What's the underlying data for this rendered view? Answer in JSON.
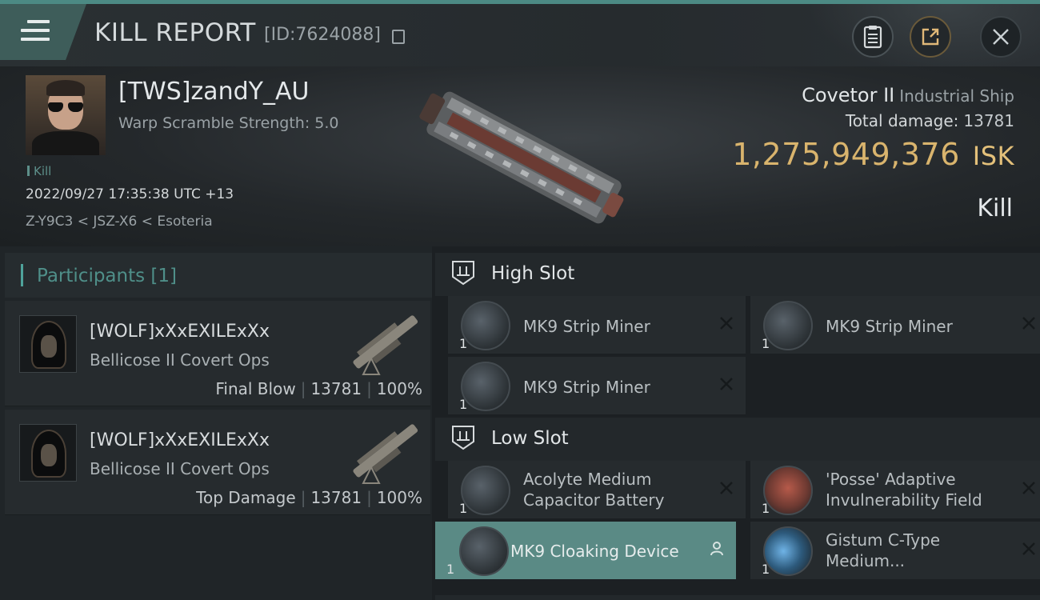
{
  "header": {
    "title": "KILL REPORT",
    "report_id": "[ID:7624088]"
  },
  "victim": {
    "name": "[TWS]zandY_AU",
    "warp_scramble": "Warp Scramble Strength: 5.0",
    "tag": "Kill",
    "datetime": "2022/09/27 17:35:38 UTC +13",
    "location": "Z-Y9C3 < JSZ-X6 < Esoteria"
  },
  "ship": {
    "name": "Covetor II",
    "class": "Industrial Ship",
    "total_damage_label": "Total damage:",
    "total_damage": "13781",
    "isk_value": "1,275,949,376",
    "isk_unit": "ISK",
    "result": "Kill"
  },
  "participants": {
    "label": "Participants",
    "count": "[1]",
    "items": [
      {
        "name": "[WOLF]xXxEXILExXx",
        "ship": "Bellicose II Covert Ops",
        "role": "Final Blow",
        "damage": "13781",
        "percent": "100%"
      },
      {
        "name": "[WOLF]xXxEXILExXx",
        "ship": "Bellicose II Covert Ops",
        "role": "Top Damage",
        "damage": "13781",
        "percent": "100%"
      }
    ]
  },
  "fitting": {
    "high_slot_label": "High Slot",
    "low_slot_label": "Low Slot",
    "high": [
      {
        "qty": "1",
        "name": "MK9 Strip Miner"
      },
      {
        "qty": "1",
        "name": "MK9 Strip Miner"
      },
      {
        "qty": "1",
        "name": "MK9 Strip Miner"
      }
    ],
    "low": [
      {
        "qty": "1",
        "line1": "Acolyte Medium",
        "line2": "Capacitor Battery"
      },
      {
        "qty": "1",
        "line1": "'Posse' Adaptive",
        "line2": "Invulnerability Field"
      },
      {
        "qty": "1",
        "line1": "MK9 Cloaking Device",
        "line2": ""
      },
      {
        "qty": "1",
        "line1": "Gistum C-Type",
        "line2": "Medium..."
      }
    ]
  },
  "colors": {
    "accent": "#4fa39b",
    "isk": "#d9b46d",
    "highlight": "#5a8a85"
  }
}
